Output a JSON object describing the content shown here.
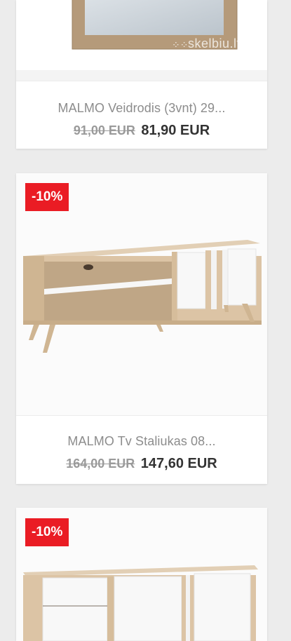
{
  "products": [
    {
      "title": "MALMO Veidrodis (3vnt) 29...",
      "old_price": "91,00 EUR",
      "new_price": "81,90 EUR",
      "watermark": "skelbiu.lt"
    },
    {
      "badge": "-10%",
      "title": "MALMO Tv Staliukas 08...",
      "old_price": "164,00 EUR",
      "new_price": "147,60 EUR"
    },
    {
      "badge": "-10%"
    }
  ],
  "colors": {
    "badge": "#ea1c24",
    "page_background": "#ececec",
    "card_background": "#ffffff",
    "title_text": "#8c8c8c",
    "old_price_text": "#9a9a9a",
    "new_price_text": "#333333"
  }
}
